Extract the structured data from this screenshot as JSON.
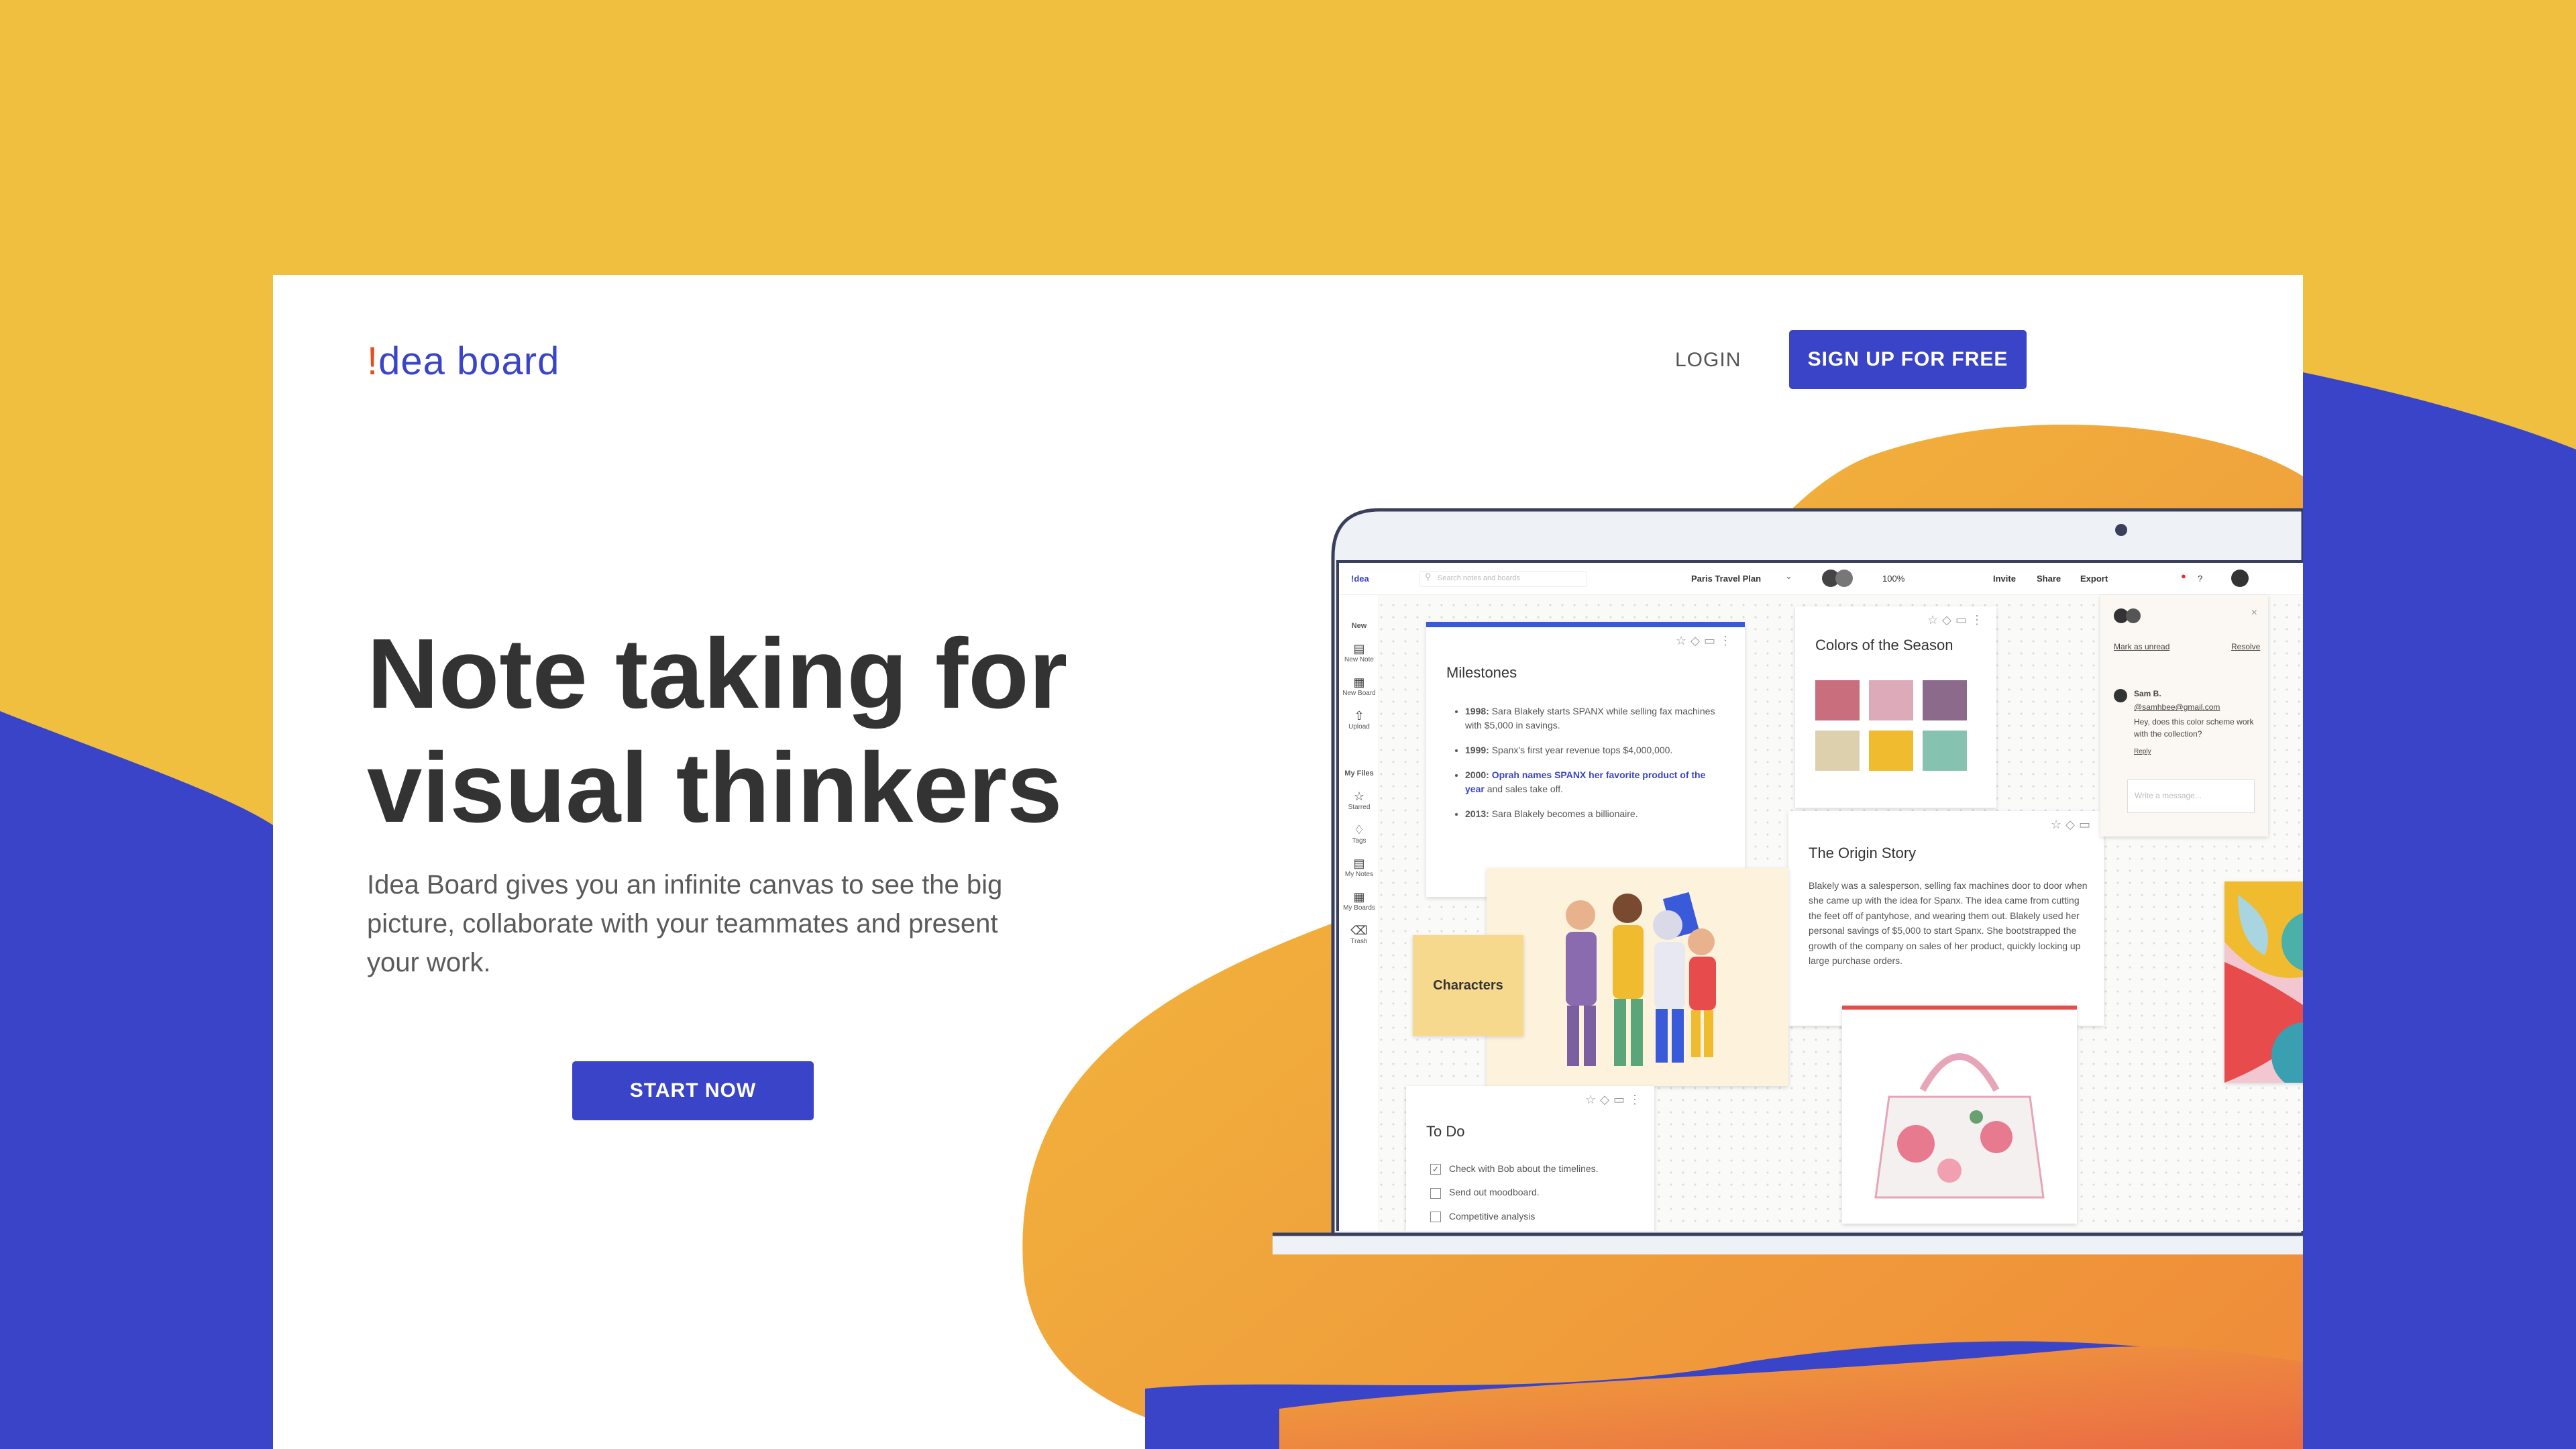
{
  "colors": {
    "yellow": "#f0bf3f",
    "blue": "#3a44c9",
    "orange": "#f0a03a",
    "accent": "#e84b1c"
  },
  "header": {
    "logo_mark": "!",
    "logo_text": "dea board",
    "login_label": "LOGIN",
    "signup_label": "SIGN UP FOR FREE"
  },
  "hero": {
    "title": "Note taking for\nvisual thinkers",
    "subtitle": "Idea Board gives you an infinite canvas to see the big picture, collaborate with your teammates and present your work.",
    "cta_label": "START NOW"
  },
  "app": {
    "logo": "!dea",
    "search_placeholder": "Search notes and boards",
    "board_name": "Paris Travel Plan",
    "zoom": "100%",
    "invite": "Invite",
    "share": "Share",
    "export": "Export",
    "help": "?",
    "sidebar": {
      "new_heading": "New",
      "new_note": "New Note",
      "new_board": "New Board",
      "upload": "Upload",
      "files_heading": "My Files",
      "starred": "Starred",
      "tags": "Tags",
      "my_notes": "My Notes",
      "my_boards": "My Boards",
      "trash": "Trash"
    },
    "milestones": {
      "title": "Milestones",
      "items": [
        {
          "year": "1998:",
          "text": " Sara Blakely starts SPANX while selling fax machines with $5,000 in savings."
        },
        {
          "year": "1999:",
          "text": " Spanx's first year revenue tops $4,000,000."
        },
        {
          "year": "2000:",
          "link": " Oprah names SPANX her favorite product of the year",
          "text": " and sales take off."
        },
        {
          "year": "2013:",
          "text": " Sara Blakely becomes a billionaire."
        }
      ]
    },
    "colors_note": {
      "title": "Colors of the Season",
      "swatches": [
        "#c96e7d",
        "#dcaab8",
        "#8c6a8c",
        "#ddd0ad",
        "#f0bb2e",
        "#86c2b0"
      ]
    },
    "origin": {
      "title": "The Origin Story",
      "body": "Blakely was a salesperson, selling fax machines door to door when she came up with the idea for Spanx. The idea came from cutting the feet off of pantyhose, and wearing them out. Blakely used her personal savings of $5,000 to start Spanx. She bootstrapped the growth of the company on sales of her product, quickly locking up large purchase orders."
    },
    "characters": "Characters",
    "todo": {
      "title": "To Do",
      "items": [
        {
          "label": "Check with Bob about the timelines.",
          "done": true
        },
        {
          "label": "Send out moodboard.",
          "done": false
        },
        {
          "label": "Competitive analysis",
          "done": false
        }
      ]
    },
    "comments": {
      "mark_unread": "Mark as unread",
      "resolve": "Resolve",
      "author": "Sam B.",
      "mention": "@samhbee@gmail.com",
      "message": "Hey, does this color scheme work with the collection?",
      "reply": "Reply",
      "input_placeholder": "Write a message..."
    }
  }
}
